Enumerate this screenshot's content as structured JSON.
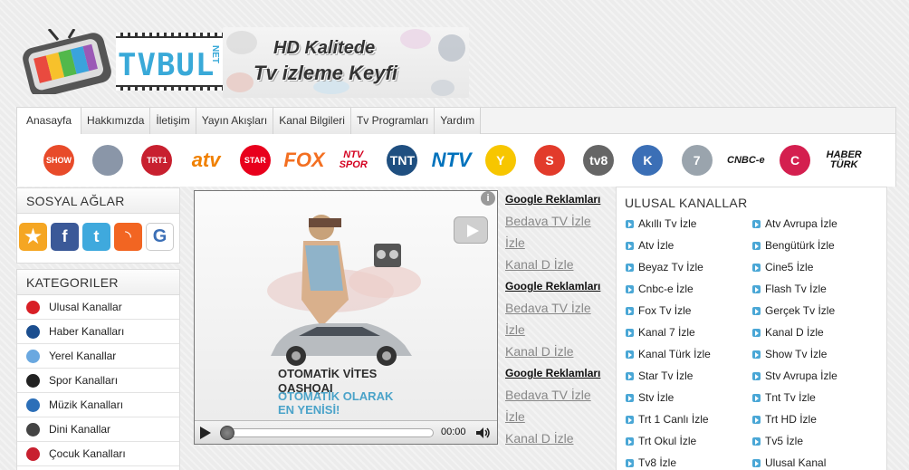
{
  "header": {
    "logo_text": "TVBUL",
    "logo_suffix": "NET",
    "banner_line1": "HD Kalitede",
    "banner_line2": "Tv izleme Keyfi"
  },
  "nav": {
    "items": [
      "Anasayfa",
      "Hakkımızda",
      "İletişim",
      "Yayın Akışları",
      "Kanal Bilgileri",
      "Tv Programları",
      "Yardım"
    ]
  },
  "channel_logos": [
    {
      "name": "show-tv",
      "label": "SHOW",
      "color": "#e84b2a"
    },
    {
      "name": "kanal-d",
      "label": "",
      "color": "#8a96a8"
    },
    {
      "name": "trt1",
      "label": "TRT1",
      "color": "#c8202f"
    },
    {
      "name": "atv",
      "label": "atv",
      "color": "#f08000"
    },
    {
      "name": "star-tv",
      "label": "STAR",
      "color": "#e8001c"
    },
    {
      "name": "fox",
      "label": "FOX",
      "color": "#f36f21"
    },
    {
      "name": "ntv-spor",
      "label": "NTV SPOR",
      "color": "#d4001f"
    },
    {
      "name": "tnt",
      "label": "TNT",
      "color": "#1f4f80"
    },
    {
      "name": "ntv",
      "label": "NTV",
      "color": "#0072bc"
    },
    {
      "name": "kanal-y",
      "label": "Y",
      "color": "#f7c600"
    },
    {
      "name": "s-tv",
      "label": "S",
      "color": "#e23b2b"
    },
    {
      "name": "tv8",
      "label": "tv8",
      "color": "#666666"
    },
    {
      "name": "kanalturk",
      "label": "K",
      "color": "#3b6fb6"
    },
    {
      "name": "kanal-7",
      "label": "7",
      "color": "#9aa4ad"
    },
    {
      "name": "cnbc-e",
      "label": "CNBC-e",
      "color": "#1a1a1a"
    },
    {
      "name": "cine5",
      "label": "C",
      "color": "#d41f4f"
    },
    {
      "name": "haberturk",
      "label": "HABER TÜRK",
      "color": "#111111"
    }
  ],
  "social": {
    "title": "SOSYAL AĞLAR",
    "icons": [
      {
        "name": "favorite-star-icon",
        "color": "#f5a623",
        "glyph": "★"
      },
      {
        "name": "facebook-icon",
        "color": "#3b5998",
        "glyph": "f"
      },
      {
        "name": "twitter-icon",
        "color": "#3fa9dd",
        "glyph": "t"
      },
      {
        "name": "rss-icon",
        "color": "#f26522",
        "glyph": "◝"
      },
      {
        "name": "google-icon",
        "color": "#ffffff",
        "glyph": "G"
      }
    ]
  },
  "categories": {
    "title": "KATEGORILER",
    "items": [
      {
        "label": "Ulusal Kanallar",
        "color": "#d81f26"
      },
      {
        "label": "Haber Kanalları",
        "color": "#1b4e8f"
      },
      {
        "label": "Yerel Kanallar",
        "color": "#6aa8e0"
      },
      {
        "label": "Spor Kanalları",
        "color": "#222222"
      },
      {
        "label": "Müzik Kanalları",
        "color": "#2c6fb8"
      },
      {
        "label": "Dini Kanallar",
        "color": "#444444"
      },
      {
        "label": "Çocuk Kanalları",
        "color": "#c8202f"
      }
    ]
  },
  "video": {
    "ad_line1": "OTOMATİK VİTES",
    "ad_line2": "QASHQAI",
    "ad_line3": "OTOMATİK OLARAK",
    "ad_line4": "EN YENİSİ!",
    "info_glyph": "i",
    "time": "00:00"
  },
  "google_ads": [
    {
      "head": "Google Reklamları",
      "links": [
        "Bedava TV İzle",
        "İzle",
        "Kanal D İzle"
      ]
    },
    {
      "head": "Google Reklamları",
      "links": [
        "Bedava TV İzle",
        "İzle",
        "Kanal D İzle"
      ]
    },
    {
      "head": "Google Reklamları",
      "links": [
        "Bedava TV İzle",
        "İzle",
        "Kanal D İzle"
      ]
    }
  ],
  "national": {
    "title": "ULUSAL KANALLAR",
    "left": [
      "Akıllı Tv İzle",
      "Atv İzle",
      "Beyaz Tv İzle",
      "Cnbc-e İzle",
      "Fox Tv İzle",
      "Kanal 7 İzle",
      "Kanal Türk İzle",
      "Star Tv İzle",
      "Stv İzle",
      "Trt 1 Canlı İzle",
      "Trt Okul İzle",
      "Tv8 İzle"
    ],
    "right": [
      "Atv Avrupa İzle",
      "Bengütürk İzle",
      "Cine5 İzle",
      "Flash Tv İzle",
      "Gerçek Tv İzle",
      "Kanal D İzle",
      "Show Tv İzle",
      "Stv Avrupa İzle",
      "Tnt Tv İzle",
      "Trt HD İzle",
      "Tv5 İzle",
      "Ulusal Kanal"
    ]
  }
}
